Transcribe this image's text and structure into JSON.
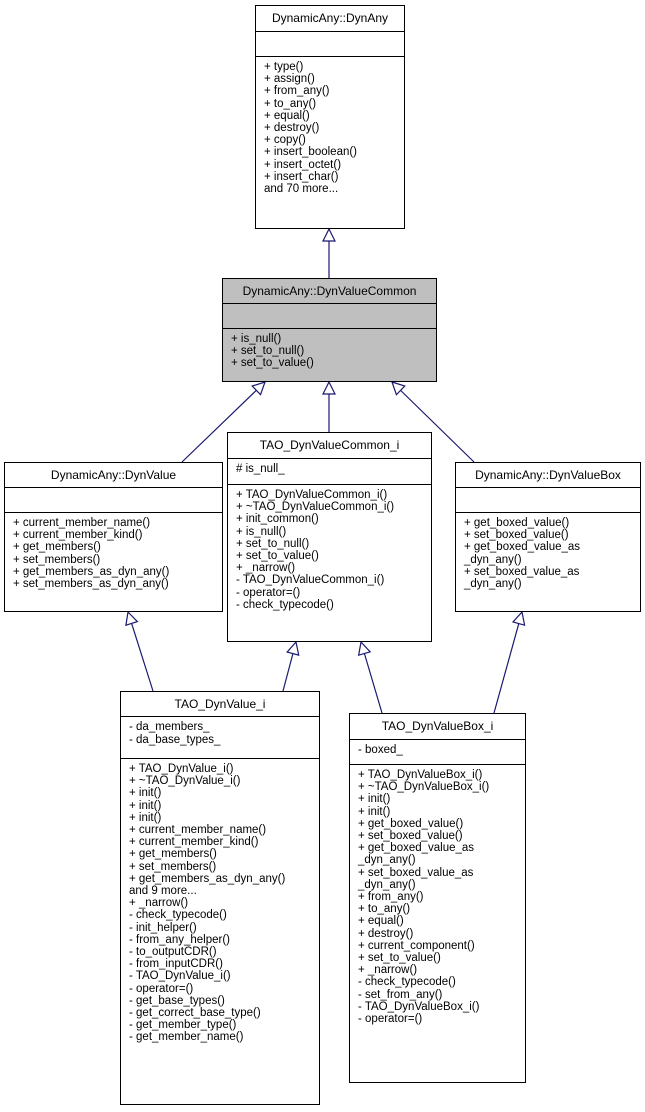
{
  "diagram": {
    "type": "uml-class-inheritance",
    "classes": {
      "dynany": {
        "name": "DynamicAny::DynAny",
        "attributes": [],
        "operations": [
          "+ type()",
          "+ assign()",
          "+ from_any()",
          "+ to_any()",
          "+ equal()",
          "+ destroy()",
          "+ copy()",
          "+ insert_boolean()",
          "+ insert_octet()",
          "+ insert_char()",
          "and 70 more..."
        ]
      },
      "dynvaluecommon": {
        "name": "DynamicAny::DynValueCommon",
        "highlighted": true,
        "attributes": [],
        "operations": [
          "+ is_null()",
          "+ set_to_null()",
          "+ set_to_value()"
        ]
      },
      "dynvalue": {
        "name": "DynamicAny::DynValue",
        "attributes": [],
        "operations": [
          "+ current_member_name()",
          "+ current_member_kind()",
          "+ get_members()",
          "+ set_members()",
          "+ get_members_as_dyn_any()",
          "+ set_members_as_dyn_any()"
        ]
      },
      "taodynvaluecommon": {
        "name": "TAO_DynValueCommon_i",
        "attributes": [
          "# is_null_"
        ],
        "operations": [
          "+ TAO_DynValueCommon_i()",
          "+ ~TAO_DynValueCommon_i()",
          "+ init_common()",
          "+ is_null()",
          "+ set_to_null()",
          "+ set_to_value()",
          "+ _narrow()",
          "- TAO_DynValueCommon_i()",
          "- operator=()",
          "- check_typecode()"
        ]
      },
      "dynvaluebox": {
        "name": "DynamicAny::DynValueBox",
        "attributes": [],
        "operations": [
          "+ get_boxed_value()",
          "+ set_boxed_value()",
          "+ get_boxed_value_as",
          "_dyn_any()",
          "+ set_boxed_value_as",
          "_dyn_any()"
        ]
      },
      "taodynvalue": {
        "name": "TAO_DynValue_i",
        "attributes": [
          "- da_members_",
          "- da_base_types_"
        ],
        "operations": [
          "+ TAO_DynValue_i()",
          "+ ~TAO_DynValue_i()",
          "+ init()",
          "+ init()",
          "+ init()",
          "+ current_member_name()",
          "+ current_member_kind()",
          "+ get_members()",
          "+ set_members()",
          "+ get_members_as_dyn_any()",
          "and 9 more...",
          "+ _narrow()",
          "- check_typecode()",
          "- init_helper()",
          "- from_any_helper()",
          "- to_outputCDR()",
          "- from_inputCDR()",
          "- TAO_DynValue_i()",
          "- operator=()",
          "- get_base_types()",
          "- get_correct_base_type()",
          "- get_member_type()",
          "- get_member_name()"
        ]
      },
      "taodynvaluebox": {
        "name": "TAO_DynValueBox_i",
        "attributes": [
          "- boxed_"
        ],
        "operations": [
          "+ TAO_DynValueBox_i()",
          "+ ~TAO_DynValueBox_i()",
          "+ init()",
          "+ init()",
          "+ get_boxed_value()",
          "+ set_boxed_value()",
          "+ get_boxed_value_as",
          "_dyn_any()",
          "+ set_boxed_value_as",
          "_dyn_any()",
          "+ from_any()",
          "+ to_any()",
          "+ equal()",
          "+ destroy()",
          "+ current_component()",
          "+ set_to_value()",
          "+ _narrow()",
          "- check_typecode()",
          "- set_from_any()",
          "- TAO_DynValueBox_i()",
          "- operator=()"
        ]
      }
    },
    "inheritance": [
      {
        "child": "dynvaluecommon",
        "parent": "dynany"
      },
      {
        "child": "dynvalue",
        "parent": "dynvaluecommon"
      },
      {
        "child": "taodynvaluecommon",
        "parent": "dynvaluecommon"
      },
      {
        "child": "dynvaluebox",
        "parent": "dynvaluecommon"
      },
      {
        "child": "taodynvalue",
        "parent": "dynvalue"
      },
      {
        "child": "taodynvalue",
        "parent": "taodynvaluecommon"
      },
      {
        "child": "taodynvaluebox",
        "parent": "taodynvaluecommon"
      },
      {
        "child": "taodynvaluebox",
        "parent": "dynvaluebox"
      }
    ],
    "colors": {
      "edge": "#191970",
      "highlight_fill": "#bfbfbf",
      "border": "#000000"
    }
  }
}
